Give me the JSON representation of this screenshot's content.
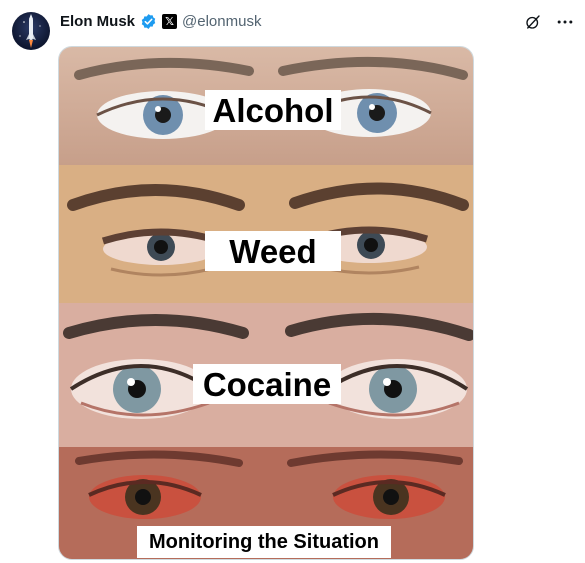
{
  "post": {
    "author_name": "Elon Musk",
    "handle": "@elonmusk",
    "x_badge": "𝕏"
  },
  "icons": {
    "avatar": "profile-avatar",
    "verified": "verified-badge-icon",
    "grok": "grok-icon",
    "more": "more-options-icon"
  },
  "colors": {
    "verified_blue": "#1d9bf0",
    "handle_gray": "#536471"
  },
  "meme": {
    "panels": [
      {
        "label": "Alcohol",
        "iris": "#6f8fae",
        "sclera": "#f4f2f0"
      },
      {
        "label": "Weed",
        "iris": "#3e4a55",
        "sclera": "#efd9cf"
      },
      {
        "label": "Cocaine",
        "iris": "#7f98a2",
        "sclera": "#f2e2dc"
      },
      {
        "label": "Monitoring the Situation",
        "iris": "#4a3420",
        "sclera": "#c9513f"
      }
    ]
  }
}
